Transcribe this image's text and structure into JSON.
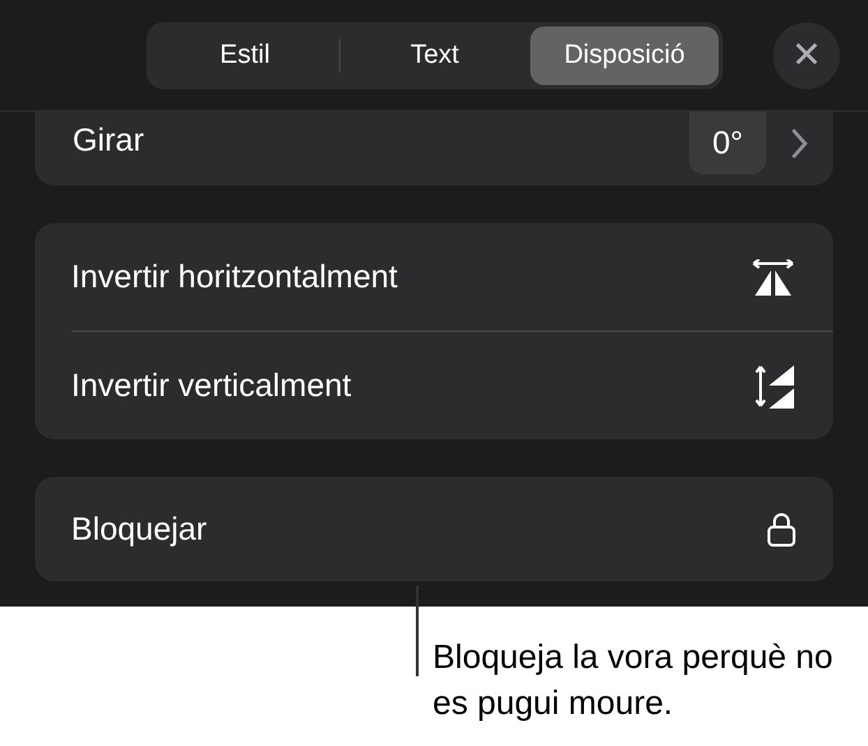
{
  "tabs": [
    {
      "label": "Estil",
      "selected": false
    },
    {
      "label": "Text",
      "selected": false
    },
    {
      "label": "Disposició",
      "selected": true
    }
  ],
  "close": {
    "label": "✕"
  },
  "rotate": {
    "label": "Girar",
    "value": "0°"
  },
  "flip_rows": [
    {
      "label": "Invertir horitzontalment",
      "kind": "horizontal"
    },
    {
      "label": "Invertir verticalment",
      "kind": "vertical"
    }
  ],
  "lock": {
    "label": "Bloquejar"
  },
  "callout": {
    "text": "Bloqueja la vora perquè no es pugui moure."
  }
}
